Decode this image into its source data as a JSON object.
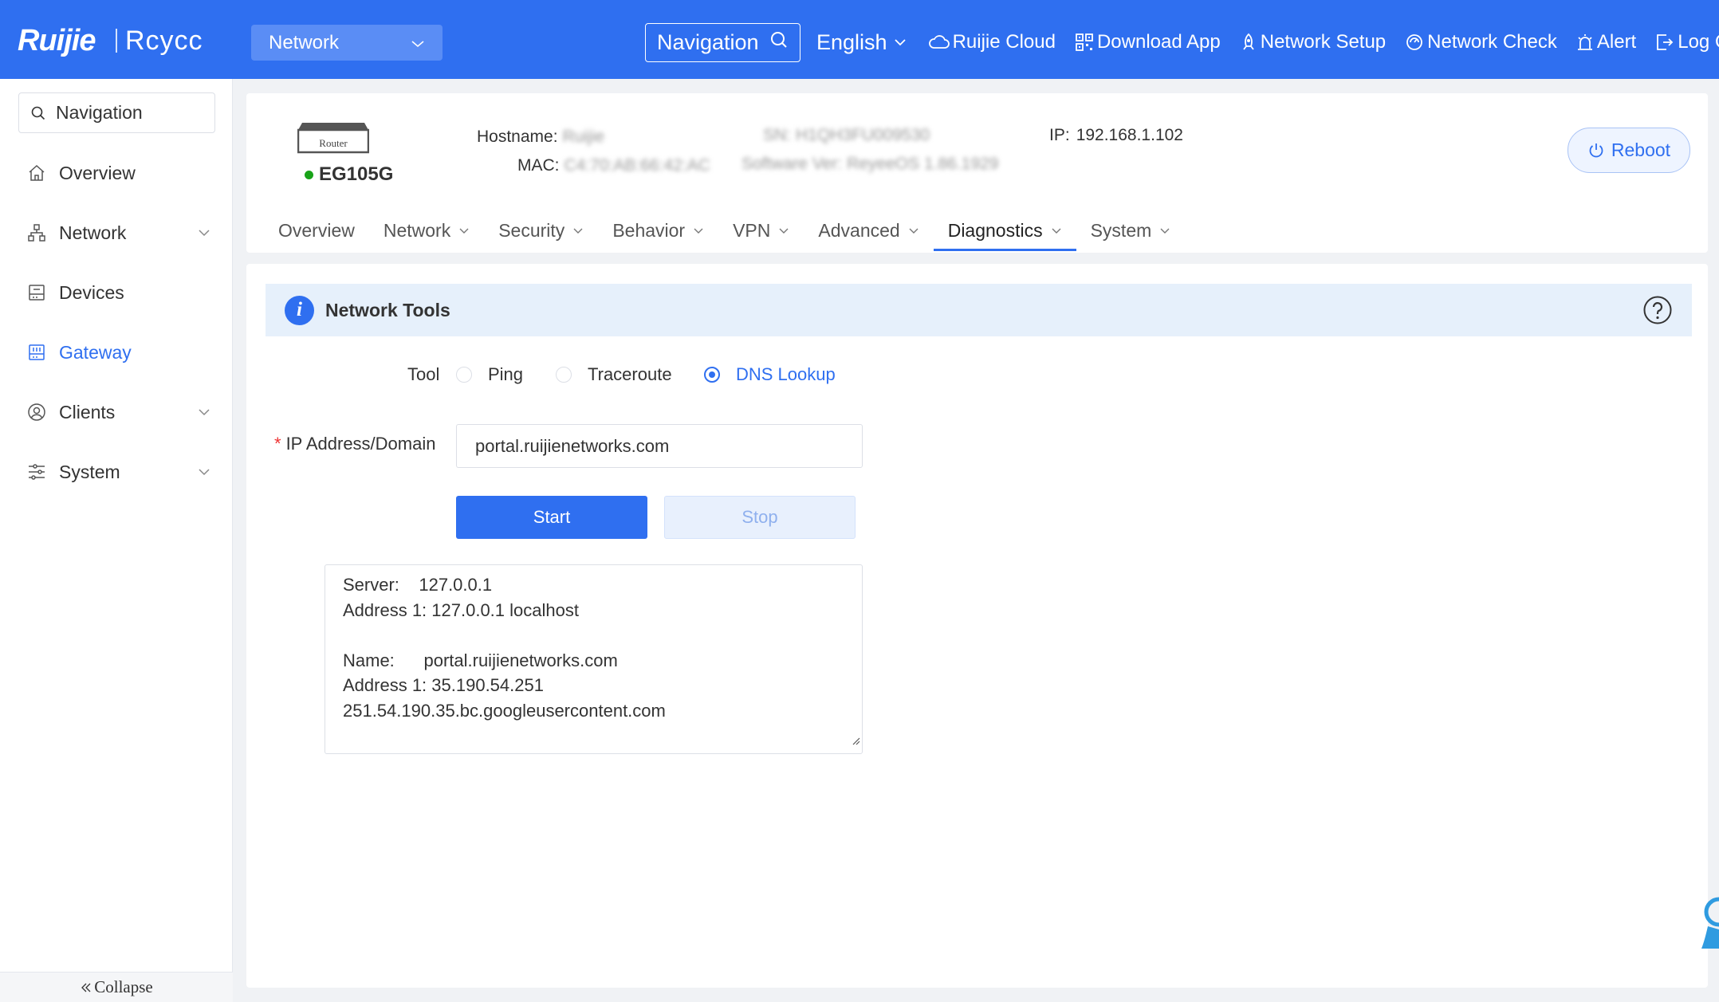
{
  "header": {
    "logo_brand": "Ruijie",
    "logo_sub": "Rcycc",
    "network_select": "Network",
    "nav_search_label": "Navigation",
    "language": "English",
    "links": {
      "cloud": "Ruijie Cloud",
      "download": "Download App",
      "setup": "Network Setup",
      "check": "Network Check",
      "alert": "Alert",
      "logout": "Log Out"
    }
  },
  "sidebar": {
    "search_label": "Navigation",
    "items": {
      "overview": "Overview",
      "network": "Network",
      "devices": "Devices",
      "gateway": "Gateway",
      "clients": "Clients",
      "system": "System"
    },
    "collapse": "Collapse"
  },
  "device": {
    "type_label": "Router",
    "model": "EG105G",
    "hostname_label": "Hostname:",
    "hostname_value": "Ruijie",
    "mac_label": "MAC:",
    "mac_value": "C4:70:AB:66:42:AC",
    "sn_label": "SN:",
    "sn_value": "H1QH3FU009530",
    "software_label": "Software Ver:",
    "software_value": "ReyeeOS 1.86.1929",
    "ip_label": "IP:",
    "ip_value": "192.168.1.102",
    "reboot": "Reboot"
  },
  "tabs": {
    "overview": "Overview",
    "network": "Network",
    "security": "Security",
    "behavior": "Behavior",
    "vpn": "VPN",
    "advanced": "Advanced",
    "diagnostics": "Diagnostics",
    "system": "System"
  },
  "tools": {
    "title": "Network Tools",
    "tool_label": "Tool",
    "options": {
      "ping": "Ping",
      "traceroute": "Traceroute",
      "dns": "DNS Lookup"
    },
    "selected": "DNS Lookup",
    "required_mark": "*",
    "ip_label": "IP Address/Domain",
    "ip_value": "portal.ruijienetworks.com",
    "start": "Start",
    "stop": "Stop",
    "result": {
      "l1": "Server:    127.0.0.1",
      "l2": "Address 1: 127.0.0.1 localhost",
      "l3": "",
      "l4": "Name:      portal.ruijienetworks.com",
      "l5": "Address 1: 35.190.54.251",
      "l6": "251.54.190.35.bc.googleusercontent.com"
    }
  },
  "colors": {
    "primary": "#2f6ff0",
    "header_bg": "#2f6ff0",
    "status_online": "#19a319"
  }
}
